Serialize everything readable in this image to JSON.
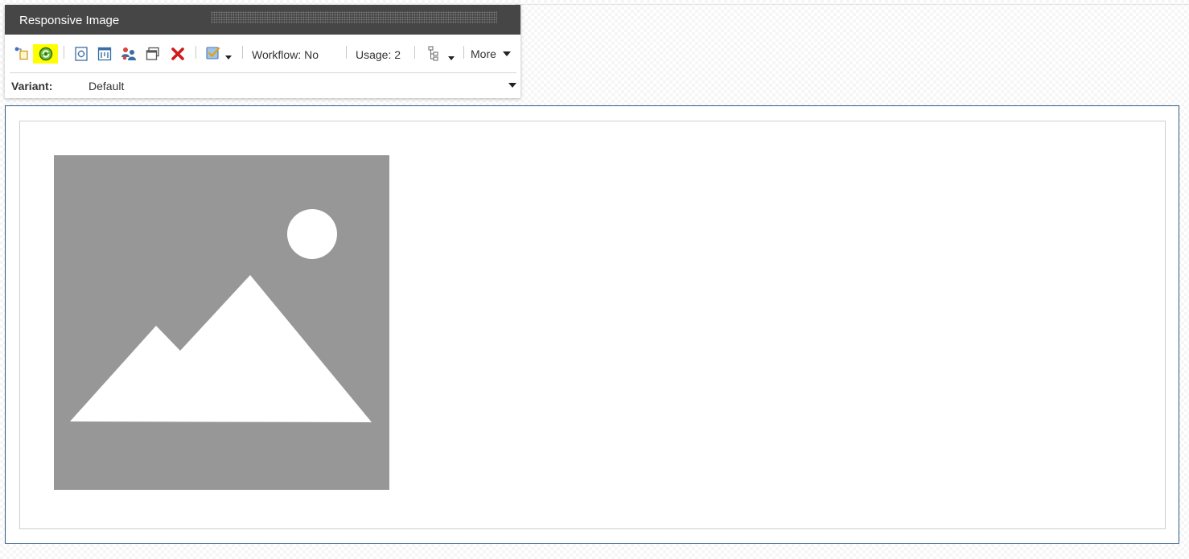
{
  "chrome": {
    "title": "Responsive Image",
    "toolbar": {
      "icons": [
        "insert-icon",
        "refresh-icon",
        "edit-item-icon",
        "layout-icon",
        "personalize-icon",
        "window-icon",
        "delete-icon",
        "test-icon",
        "tree-icon"
      ],
      "workflow_label": "Workflow: No",
      "usage_label": "Usage: 2",
      "more_label": "More"
    },
    "variant": {
      "label": "Variant:",
      "value": "Default"
    }
  },
  "colors": {
    "header_bg": "#464646",
    "highlight": "#ffff00",
    "rendering_border": "#2e5a86",
    "placeholder_gray": "#979797",
    "delete_red": "#d11a1a"
  }
}
